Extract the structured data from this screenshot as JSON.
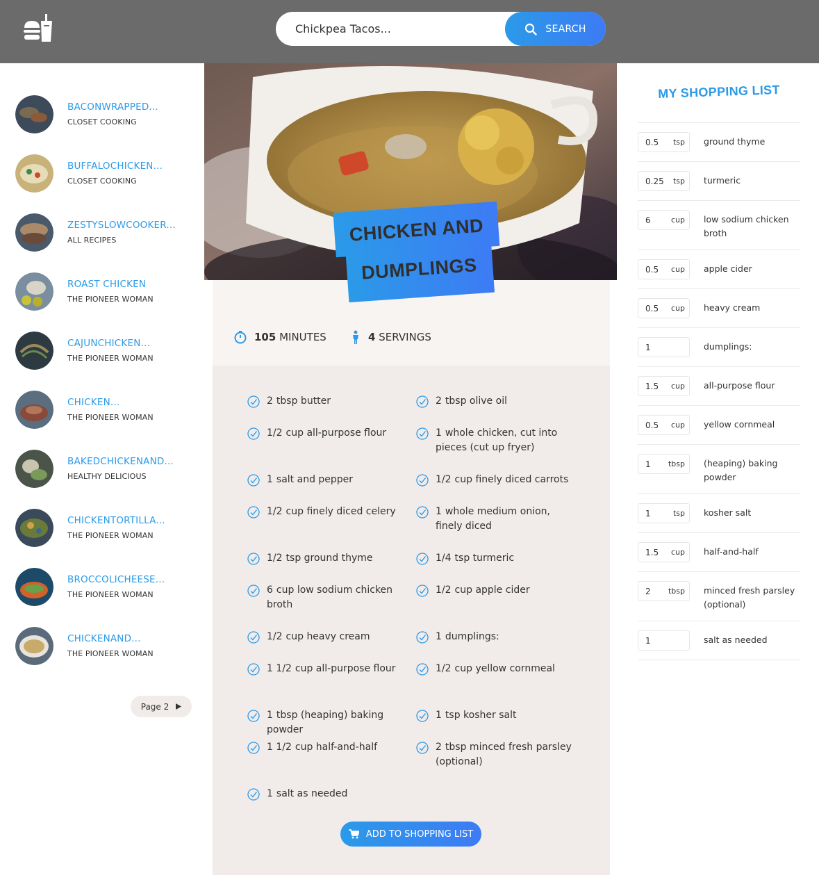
{
  "header": {
    "search_value": "Chickpea Tacos...",
    "search_label": "SEARCH"
  },
  "results": [
    {
      "title": "BACONWRAPPED...",
      "publisher": "CLOSET COOKING"
    },
    {
      "title": "BUFFALOCHICKEN...",
      "publisher": "CLOSET COOKING"
    },
    {
      "title": "ZESTYSLOWCOOKER...",
      "publisher": "ALL RECIPES"
    },
    {
      "title": "ROAST CHICKEN",
      "publisher": "THE PIONEER WOMAN"
    },
    {
      "title": "CAJUNCHICKEN...",
      "publisher": "THE PIONEER WOMAN"
    },
    {
      "title": "CHICKEN...",
      "publisher": "THE PIONEER WOMAN"
    },
    {
      "title": "BAKEDCHICKENAND...",
      "publisher": "HEALTHY DELICIOUS"
    },
    {
      "title": "CHICKENTORTILLA...",
      "publisher": "THE PIONEER WOMAN"
    },
    {
      "title": "BROCCOLICHEESE...",
      "publisher": "THE PIONEER WOMAN"
    },
    {
      "title": "CHICKENAND...",
      "publisher": "THE PIONEER WOMAN"
    }
  ],
  "pagination": {
    "next_label": "Page 2"
  },
  "recipe": {
    "title_line1": "CHICKEN AND",
    "title_line2": "DUMPLINGS",
    "minutes": "105",
    "minutes_label": "MINUTES",
    "servings": "4",
    "servings_label": "SERVINGS",
    "ingredients": [
      {
        "qty": "2",
        "text": "tbsp butter"
      },
      {
        "qty": "2",
        "text": "tbsp olive oil"
      },
      {
        "qty": "1/2",
        "text": "cup all-purpose flour"
      },
      {
        "qty": "1",
        "text": "whole chicken, cut into pieces (cut up fryer)"
      },
      {
        "qty": "1",
        "text": "salt and pepper"
      },
      {
        "qty": "1/2",
        "text": "cup finely diced carrots"
      },
      {
        "qty": "1/2",
        "text": "cup finely diced celery"
      },
      {
        "qty": "1",
        "text": "whole medium onion, finely diced"
      },
      {
        "qty": "1/2",
        "text": "tsp ground thyme"
      },
      {
        "qty": "1/4",
        "text": "tsp turmeric"
      },
      {
        "qty": "6",
        "text": "cup low sodium chicken broth"
      },
      {
        "qty": "1/2",
        "text": "cup apple cider"
      },
      {
        "qty": "1/2",
        "text": "cup heavy cream"
      },
      {
        "qty": "1",
        "text": "dumplings:"
      },
      {
        "qty": "1 1/2",
        "text": "cup all-purpose flour"
      },
      {
        "qty": "1/2",
        "text": "cup yellow cornmeal"
      },
      {
        "qty": "1",
        "text": "tbsp (heaping) baking powder"
      },
      {
        "qty": "1",
        "text": "tsp kosher salt"
      },
      {
        "qty": "1 1/2",
        "text": "cup half-and-half"
      },
      {
        "qty": "2",
        "text": "tbsp minced fresh parsley (optional)"
      },
      {
        "qty": "1",
        "text": "salt as needed"
      }
    ],
    "add_button_label": "ADD TO SHOPPING LIST"
  },
  "shopping": {
    "title": "MY SHOPPING LIST",
    "items": [
      {
        "qty": "0.5",
        "unit": "tsp",
        "name": "ground thyme"
      },
      {
        "qty": "0.25",
        "unit": "tsp",
        "name": "turmeric"
      },
      {
        "qty": "6",
        "unit": "cup",
        "name": "low sodium chicken broth"
      },
      {
        "qty": "0.5",
        "unit": "cup",
        "name": "apple cider"
      },
      {
        "qty": "0.5",
        "unit": "cup",
        "name": "heavy cream"
      },
      {
        "qty": "1",
        "unit": "",
        "name": "dumplings:"
      },
      {
        "qty": "1.5",
        "unit": "cup",
        "name": "all-purpose flour"
      },
      {
        "qty": "0.5",
        "unit": "cup",
        "name": "yellow cornmeal"
      },
      {
        "qty": "1",
        "unit": "tbsp",
        "name": "(heaping) baking powder"
      },
      {
        "qty": "1",
        "unit": "tsp",
        "name": "kosher salt"
      },
      {
        "qty": "1.5",
        "unit": "cup",
        "name": "half-and-half"
      },
      {
        "qty": "2",
        "unit": "tbsp",
        "name": "minced fresh parsley (optional)"
      },
      {
        "qty": "1",
        "unit": "",
        "name": "salt as needed"
      }
    ]
  },
  "colors": {
    "accent": "#2b9ae8",
    "accent2": "#3d7bf5",
    "header_bg": "#6b6b6b"
  }
}
